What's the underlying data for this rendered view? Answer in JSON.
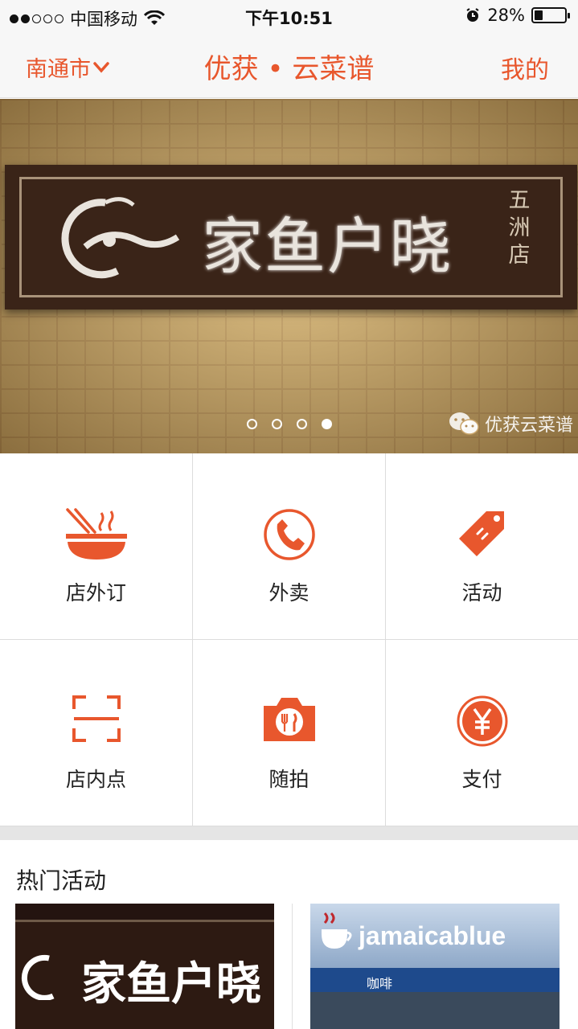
{
  "status_bar": {
    "carrier": "中国移动",
    "time": "下午10:51",
    "battery": "28%",
    "battery_level": 0.28
  },
  "header": {
    "city": "南通市",
    "title": "优获 • 云菜谱",
    "mine": "我的"
  },
  "banner": {
    "sign_name": "家鱼户晓",
    "sign_branch": "五洲店",
    "watermark": "优获云菜谱",
    "slide_count": 4,
    "active_slide": 4
  },
  "menu": [
    {
      "label": "店外订",
      "icon": "noodle-bowl-icon"
    },
    {
      "label": "外卖",
      "icon": "phone-icon"
    },
    {
      "label": "活动",
      "icon": "tag-icon"
    },
    {
      "label": "店内点",
      "icon": "scan-icon"
    },
    {
      "label": "随拍",
      "icon": "camera-icon"
    },
    {
      "label": "支付",
      "icon": "yen-icon"
    }
  ],
  "hot": {
    "title": "热门活动",
    "card1_text": "家鱼户晓",
    "card2_text": "jamaicablue",
    "card2_sub": "咖啡"
  },
  "colors": {
    "accent": "#e8572d"
  }
}
